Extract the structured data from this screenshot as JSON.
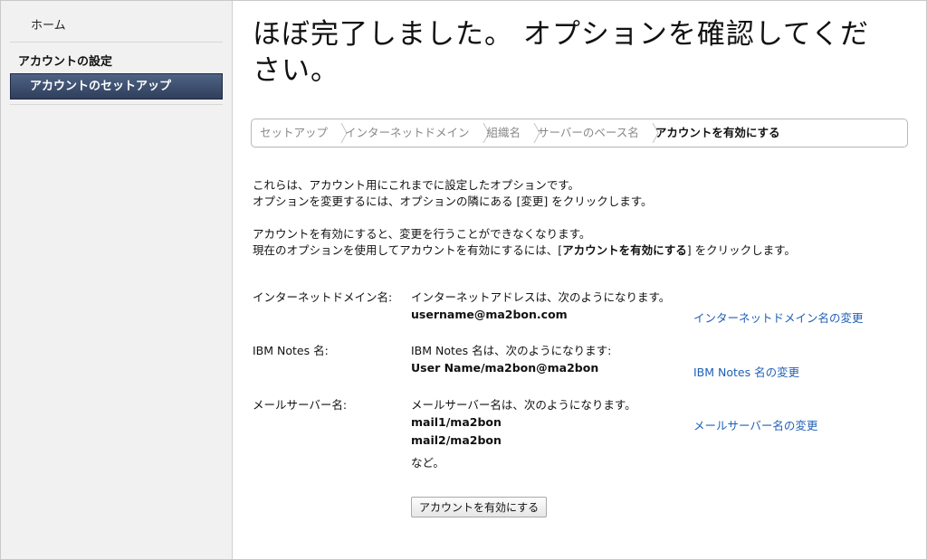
{
  "sidebar": {
    "home": "ホーム",
    "group": "アカウントの設定",
    "active_item": "アカウントのセットアップ"
  },
  "title": "ほぼ完了しました。 オプションを確認してください。",
  "breadcrumb": [
    {
      "label": "セットアップ"
    },
    {
      "label": "インターネットドメイン"
    },
    {
      "label": "組織名"
    },
    {
      "label": "サーバーのベース名"
    },
    {
      "label": "アカウントを有効にする"
    }
  ],
  "intro": {
    "line1": "これらは、アカウント用にこれまでに設定したオプションです。",
    "line2": "オプションを変更するには、オプションの隣にある [変更] をクリックします。",
    "line3": "アカウントを有効にすると、変更を行うことができなくなります。",
    "line4_pre": "現在のオプションを使用してアカウントを有効にするには、[",
    "line4_bold": "アカウントを有効にする",
    "line4_post": "] をクリックします。"
  },
  "options": {
    "domain": {
      "label": "インターネットドメイン名:",
      "desc": "インターネットアドレスは、次のようになります。",
      "value": "username@ma2bon.com",
      "link": "インターネットドメイン名の変更"
    },
    "notes": {
      "label": "IBM Notes 名:",
      "desc": "IBM Notes 名は、次のようになります:",
      "value": "User Name/ma2bon@ma2bon",
      "link": "IBM Notes 名の変更"
    },
    "mail": {
      "label": "メールサーバー名:",
      "desc": "メールサーバー名は、次のようになります。",
      "value1": "mail1/ma2bon",
      "value2": "mail2/ma2bon",
      "etc": "など。",
      "link": "メールサーバー名の変更"
    }
  },
  "enable_button": "アカウントを有効にする",
  "colors": {
    "link": "#1f5fb8",
    "sidebar_active": "#3a4c6e",
    "sidebar_bg": "#f1f1f1"
  }
}
